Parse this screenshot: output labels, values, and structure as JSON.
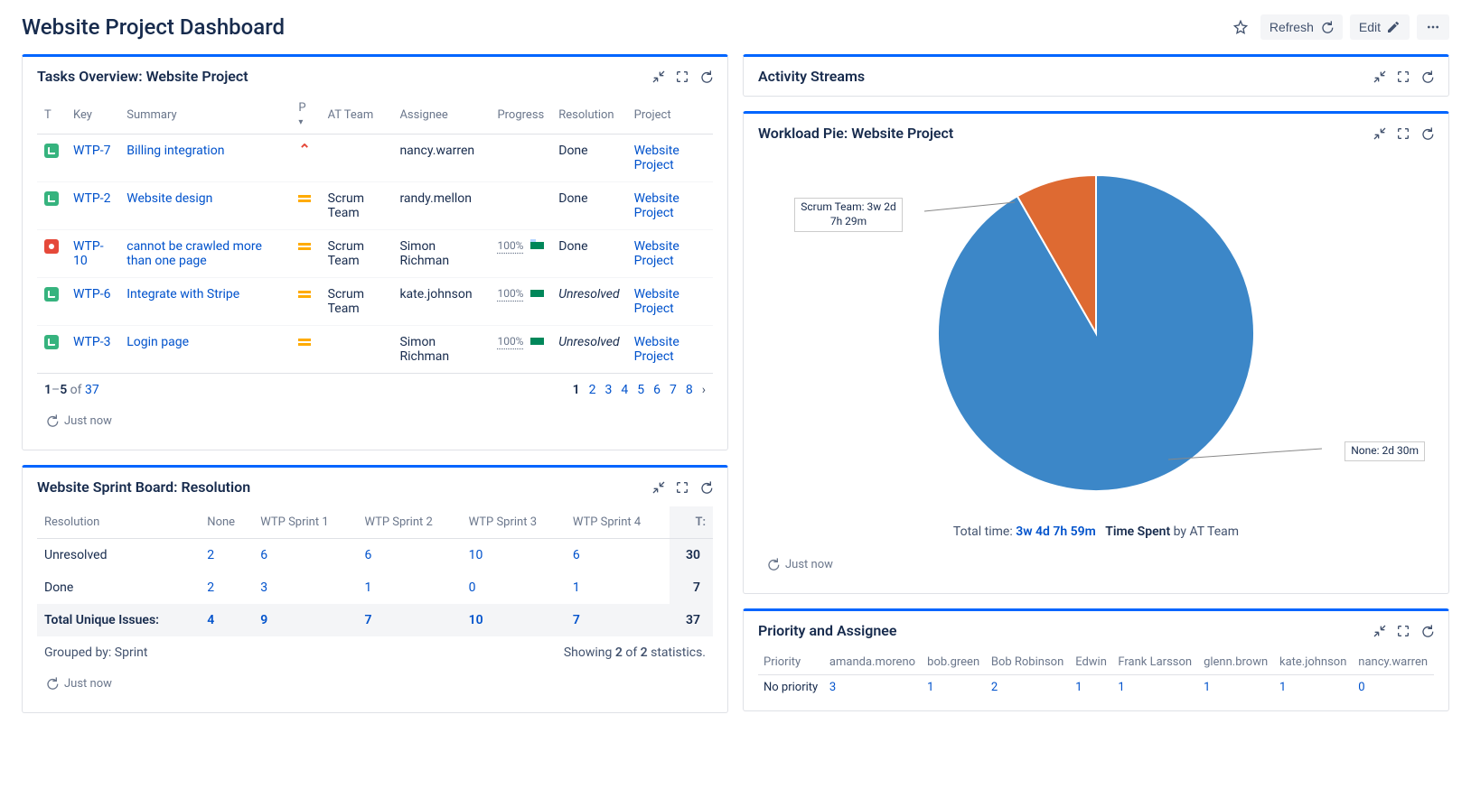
{
  "header": {
    "title": "Website Project Dashboard",
    "refresh_label": "Refresh",
    "edit_label": "Edit"
  },
  "tasks": {
    "title": "Tasks Overview: Website Project",
    "columns": {
      "t": "T",
      "key": "Key",
      "summary": "Summary",
      "p": "P",
      "team": "AT Team",
      "assignee": "Assignee",
      "progress": "Progress",
      "resolution": "Resolution",
      "project": "Project"
    },
    "rows": [
      {
        "type": "story",
        "key": "WTP-7",
        "summary": "Billing integration",
        "priority": "high",
        "team": "",
        "assignee": "nancy.warren",
        "progress": null,
        "resolution": "Done",
        "project": "Website Project"
      },
      {
        "type": "story",
        "key": "WTP-2",
        "summary": "Website design",
        "priority": "medium",
        "team": "Scrum Team",
        "assignee": "randy.mellon",
        "progress": null,
        "resolution": "Done",
        "project": "Website Project"
      },
      {
        "type": "bug",
        "key": "WTP-10",
        "summary": "cannot be crawled more than one page",
        "priority": "medium",
        "team": "Scrum Team",
        "assignee": "Simon Richman",
        "progress": 100,
        "resolution": "Done",
        "project": "Website Project"
      },
      {
        "type": "story",
        "key": "WTP-6",
        "summary": "Integrate with Stripe",
        "priority": "medium",
        "team": "Scrum Team",
        "assignee": "kate.johnson",
        "progress": 100,
        "resolution": "Unresolved",
        "project": "Website Project"
      },
      {
        "type": "story",
        "key": "WTP-3",
        "summary": "Login page",
        "priority": "medium",
        "team": "",
        "assignee": "Simon Richman",
        "progress": 100,
        "resolution": "Unresolved",
        "project": "Website Project"
      }
    ],
    "pager": {
      "range_from": "1",
      "range_dash": "–",
      "range_to": "5",
      "of": "of",
      "total": "37",
      "pages": [
        "1",
        "2",
        "3",
        "4",
        "5",
        "6",
        "7",
        "8"
      ],
      "active": "1"
    },
    "refreshed": "Just now"
  },
  "sprint": {
    "title": "Website Sprint Board: Resolution",
    "columns": [
      "Resolution",
      "None",
      "WTP Sprint 1",
      "WTP Sprint 2",
      "WTP Sprint 3",
      "WTP Sprint 4",
      "T:"
    ],
    "rows": [
      {
        "label": "Unresolved",
        "cells": [
          "2",
          "6",
          "6",
          "10",
          "6"
        ],
        "t": "30"
      },
      {
        "label": "Done",
        "cells": [
          "2",
          "3",
          "1",
          "0",
          "1"
        ],
        "t": "7"
      }
    ],
    "total_row": {
      "label": "Total Unique Issues:",
      "cells": [
        "4",
        "9",
        "7",
        "10",
        "7"
      ],
      "t": "37"
    },
    "grouped_by": "Grouped by: Sprint",
    "showing_prefix": "Showing ",
    "showing_a": "2",
    "showing_of": " of ",
    "showing_b": "2",
    "showing_suffix": " statistics.",
    "refreshed": "Just now"
  },
  "activity": {
    "title": "Activity Streams"
  },
  "workload": {
    "title": "Workload Pie: Website Project",
    "total_prefix": "Total time: ",
    "total_value": "3w 4d 7h 59m",
    "spent_label_bold": "Time Spent",
    "spent_label_rest": " by AT Team",
    "labels": {
      "scrum": "Scrum Team: 3w 2d 7h 29m",
      "none": "None: 2d 30m"
    },
    "refreshed": "Just now"
  },
  "priority": {
    "title": "Priority and Assignee",
    "columns": [
      "Priority",
      "amanda.moreno",
      "bob.green",
      "Bob Robinson",
      "Edwin",
      "Frank Larsson",
      "glenn.brown",
      "kate.johnson",
      "nancy.warren"
    ],
    "row": {
      "label": "No priority",
      "cells": [
        "3",
        "1",
        "2",
        "1",
        "1",
        "1",
        "1",
        "0"
      ]
    }
  },
  "chart_data": {
    "type": "pie",
    "title": "Workload Pie: Website Project",
    "series": [
      {
        "name": "Scrum Team",
        "label": "3w 2d 7h 29m",
        "fraction": 0.917
      },
      {
        "name": "None",
        "label": "2d 30m",
        "fraction": 0.083
      }
    ],
    "total_label": "3w 4d 7h 59m",
    "colors": {
      "Scrum Team": "#3C87C8",
      "None": "#DE6A32"
    }
  }
}
